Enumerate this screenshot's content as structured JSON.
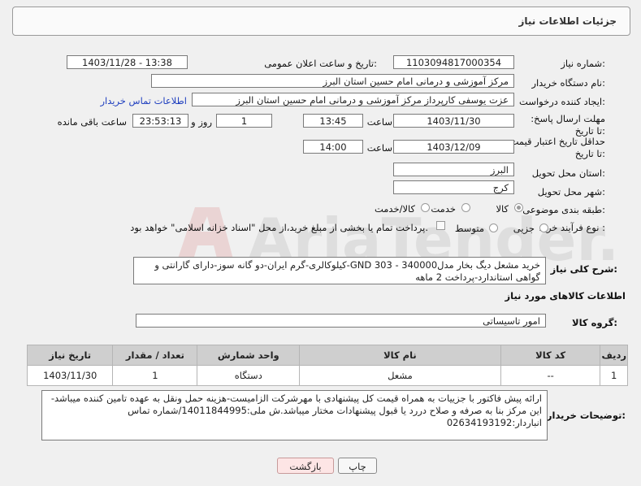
{
  "header": {
    "title": "جزئیات اطلاعات نیاز"
  },
  "fields": {
    "need_number_label": "شماره نیاز:",
    "need_number": "1103094817000354",
    "announce_label": "تاریخ و ساعت اعلان عمومی:",
    "announce_value": "1403/11/28 - 13:38",
    "buyer_org_label": "نام دستگاه خریدار:",
    "buyer_org": "مرکز آموزشی و درمانی امام حسین استان البرز",
    "creator_label": "ایجاد کننده درخواست:",
    "creator": "عزت یوسفی کارپرداز مرکز آموزشی و درمانی امام حسین استان البرز",
    "contact_link": "اطلاعات تماس خریدار",
    "deadline_label": "مهلت ارسال پاسخ: تا تاریخ:",
    "deadline_date": "1403/11/30",
    "time_label": "ساعت",
    "deadline_time": "13:45",
    "days_value": "1",
    "days_label": "روز و",
    "remaining_time": "23:53:13",
    "remaining_label": "ساعت باقی مانده",
    "validity_label": "حداقل تاریخ اعتبار قیمت: تا تاریخ:",
    "validity_date": "1403/12/09",
    "validity_time": "14:00",
    "province_label": "استان محل تحویل:",
    "province": "البرز",
    "city_label": "شهر محل تحویل:",
    "city": "کرج",
    "category_label": "طبقه بندی موضوعی:",
    "category_options": [
      "کالا",
      "خدمت",
      "کالا/خدمت"
    ],
    "process_label": "نوع فرآیند خرید :",
    "process_options": [
      "جزیی",
      "متوسط"
    ],
    "process_note": "پرداخت تمام یا بخشی از مبلغ خرید،از محل \"اسناد خزانه اسلامی\" خواهد بود."
  },
  "summary": {
    "label": "شرح کلی نیاز:",
    "text": "خرید مشعل دیگ بخار مدلGND 303 - 340000-کیلوکالری-گرم ایران-دو گانه سوز-دارای گارانتی و گواهی استاندارد-پرداخت  2 ماهه"
  },
  "goods_info_title": "اطلاعات کالاهای مورد نیاز",
  "goods_group": {
    "label": "گروه کالا:",
    "value": "امور تاسیساتی"
  },
  "table": {
    "headers": [
      "ردیف",
      "کد کالا",
      "نام کالا",
      "واحد شمارش",
      "تعداد / مقدار",
      "تاریخ نیاز"
    ],
    "rows": [
      [
        "1",
        "--",
        "مشعل",
        "دستگاه",
        "1",
        "1403/11/30"
      ]
    ]
  },
  "buyer_notes": {
    "label": "توضیحات خریدار:",
    "text": "ارائه پیش فاکتور با جزییات به همراه قیمت کل پیشنهادی با مهرشرکت الزامیست-هزینه حمل ونقل به عهده تامین کننده میباشد-این مرکز بنا به صرفه و صلاح دررد یا قبول پیشنهادات مختار میباشد.ش ملی:14011844995/شماره تماس انباردار:02634193192"
  },
  "buttons": {
    "print": "چاپ",
    "back": "بازگشت"
  },
  "watermark": "AriaTender.neT"
}
